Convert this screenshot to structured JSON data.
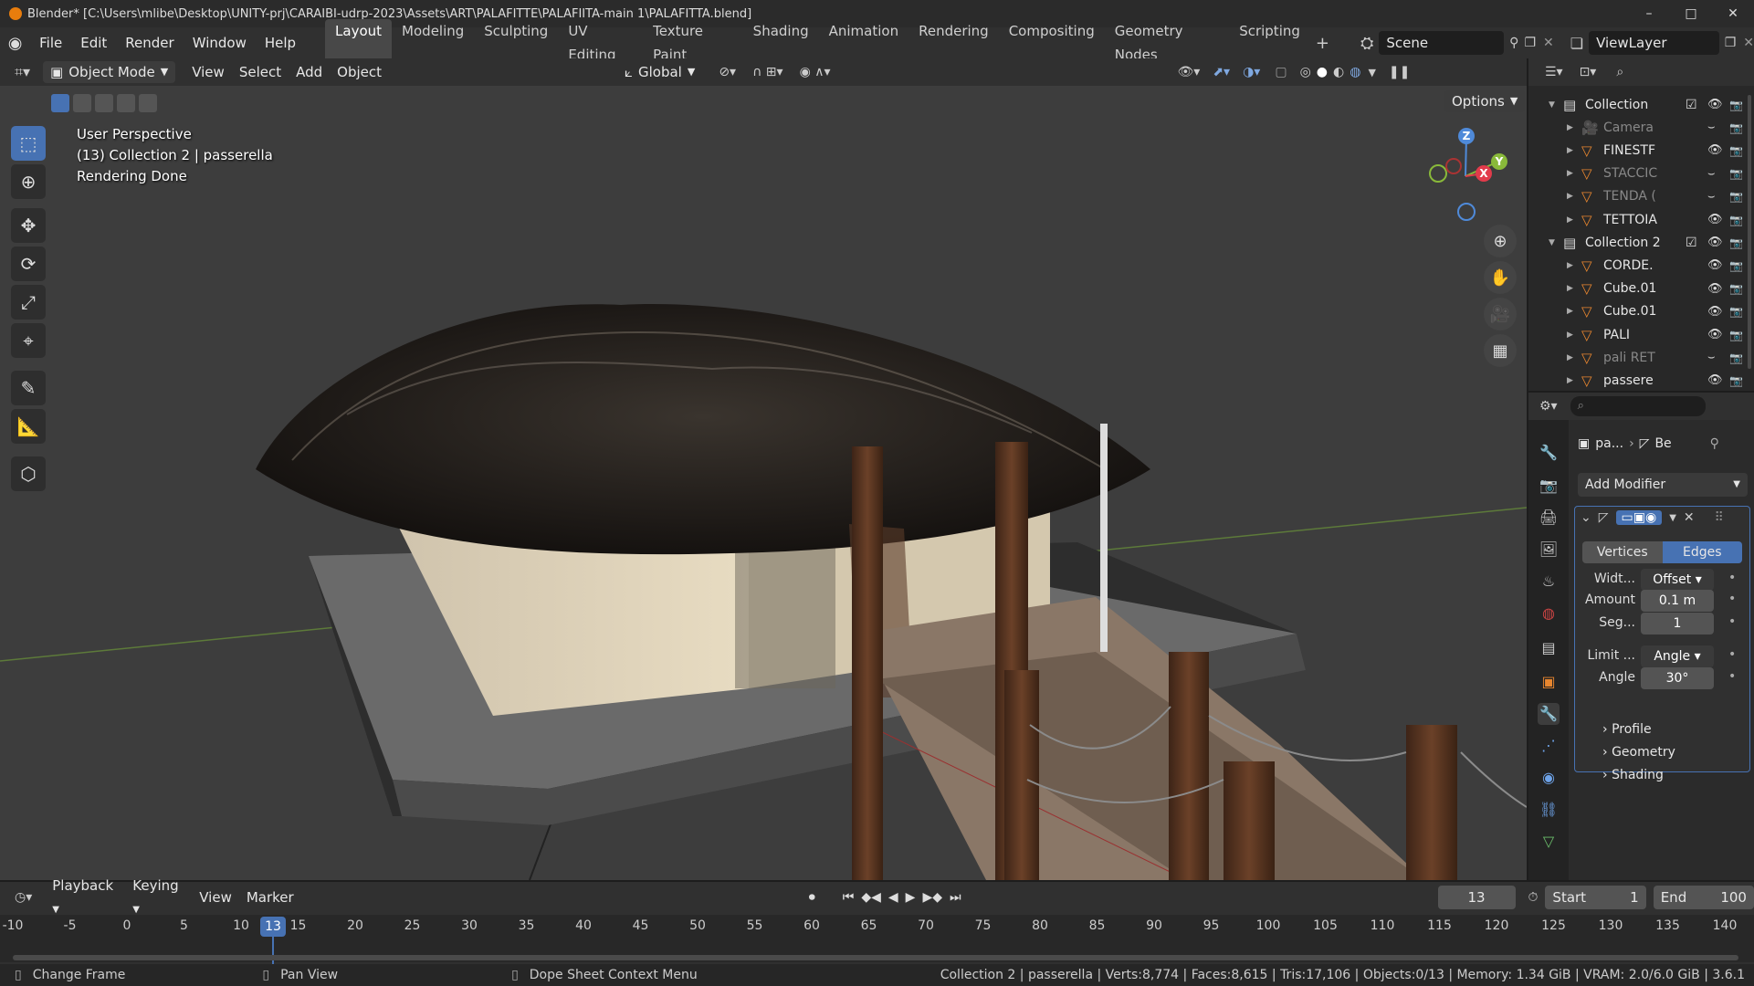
{
  "window": {
    "title": "Blender* [C:\\Users\\mlibe\\Desktop\\UNITY-prj\\CARAIBI-udrp-2023\\Assets\\ART\\PALAFITTE\\PALAFIITA-main 1\\PALAFITTA.blend]",
    "minimize": "–",
    "maximize": "□",
    "close": "✕"
  },
  "menubar": {
    "items": [
      "File",
      "Edit",
      "Render",
      "Window",
      "Help"
    ]
  },
  "workspaces": {
    "tabs": [
      "Layout",
      "Modeling",
      "Sculpting",
      "UV Editing",
      "Texture Paint",
      "Shading",
      "Animation",
      "Rendering",
      "Compositing",
      "Geometry Nodes",
      "Scripting"
    ],
    "active": "Layout",
    "add": "+"
  },
  "scene": {
    "name": "Scene",
    "view_layer": "ViewLayer"
  },
  "viewport_header": {
    "mode": "Object Mode",
    "menus": [
      "View",
      "Select",
      "Add",
      "Object"
    ],
    "orientation": "Global",
    "options": "Options"
  },
  "viewport": {
    "line1": "User Perspective",
    "line2": "(13) Collection 2 | passerella",
    "line3": "Rendering Done",
    "gizmo": {
      "x": "X",
      "y": "Y",
      "z": "Z"
    }
  },
  "outliner": {
    "rows": [
      {
        "name": "Collection",
        "type": "collection",
        "indent": 0
      },
      {
        "name": "Camera",
        "type": "camera",
        "indent": 1,
        "dim": true
      },
      {
        "name": "FINESTF",
        "type": "mesh",
        "indent": 1
      },
      {
        "name": "STACCIC",
        "type": "mesh",
        "indent": 1,
        "dim": true
      },
      {
        "name": "TENDA (",
        "type": "mesh",
        "indent": 1,
        "dim": true
      },
      {
        "name": "TETTOIA",
        "type": "mesh",
        "indent": 1
      },
      {
        "name": "Collection 2",
        "type": "collection",
        "indent": 0
      },
      {
        "name": "CORDE.",
        "type": "mesh",
        "indent": 1
      },
      {
        "name": "Cube.01",
        "type": "mesh",
        "indent": 1
      },
      {
        "name": "Cube.01",
        "type": "mesh",
        "indent": 1
      },
      {
        "name": "PALI",
        "type": "mesh",
        "indent": 1
      },
      {
        "name": "pali RET",
        "type": "mesh",
        "indent": 1,
        "dim": true
      },
      {
        "name": "passere",
        "type": "mesh",
        "indent": 1
      }
    ]
  },
  "properties": {
    "breadcrumb_object": "pa...",
    "breadcrumb_modifier": "Be",
    "add_modifier": "Add Modifier",
    "mode_tabs": [
      "Vertices",
      "Edges"
    ],
    "active_mode": "Edges",
    "fields": [
      {
        "label": "Widt...",
        "value": "Offset",
        "dropdown": true
      },
      {
        "label": "Amount",
        "value": "0.1 m"
      },
      {
        "label": "Seg...",
        "value": "1"
      },
      {
        "label": "Limit ...",
        "value": "Angle",
        "dropdown": true
      },
      {
        "label": "Angle",
        "value": "30°"
      }
    ],
    "panels": [
      "Profile",
      "Geometry",
      "Shading"
    ]
  },
  "timeline": {
    "menus": [
      "Playback",
      "Keying",
      "View",
      "Marker"
    ],
    "current_frame": "13",
    "start_label": "Start",
    "start": "1",
    "end_label": "End",
    "end": "100",
    "ticks": [
      "-10",
      "-5",
      "0",
      "5",
      "10",
      "15",
      "20",
      "25",
      "30",
      "35",
      "40",
      "45",
      "50",
      "55",
      "60",
      "65",
      "70",
      "75",
      "80",
      "85",
      "90",
      "95",
      "100",
      "105",
      "110",
      "115",
      "120",
      "125",
      "130",
      "135",
      "140"
    ]
  },
  "statusbar": {
    "hint1": "Change Frame",
    "hint2": "Pan View",
    "hint3": "Dope Sheet Context Menu",
    "stats": "Collection 2 | passerella | Verts:8,774 | Faces:8,615 | Tris:17,106 | Objects:0/13 | Memory: 1.34 GiB | VRAM: 2.0/6.0 GiB | 3.6.1"
  }
}
